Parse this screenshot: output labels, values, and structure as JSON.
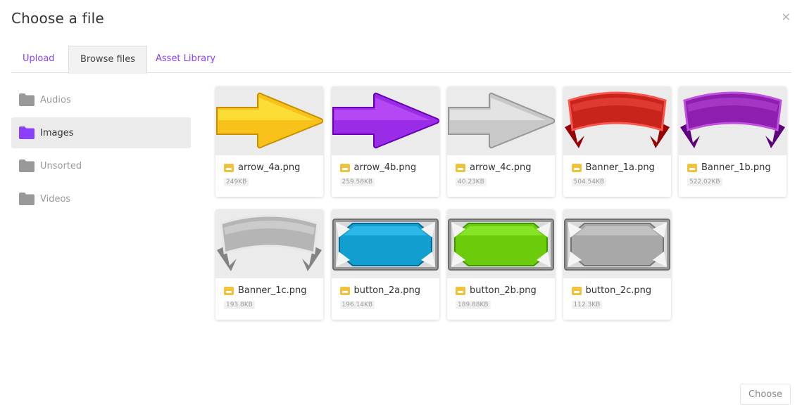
{
  "dialog": {
    "title": "Choose a file",
    "close_glyph": "×"
  },
  "tabs": [
    {
      "label": "Upload",
      "active": false
    },
    {
      "label": "Browse files",
      "active": true
    },
    {
      "label": "Asset Library",
      "active": false
    }
  ],
  "sidebar": {
    "items": [
      {
        "label": "Audios",
        "icon": "folder-icon",
        "color": "#999999",
        "active": false
      },
      {
        "label": "Images",
        "icon": "folder-icon",
        "color": "#8a3ffc",
        "active": true
      },
      {
        "label": "Unsorted",
        "icon": "folder-icon",
        "color": "#999999",
        "active": false
      },
      {
        "label": "Videos",
        "icon": "folder-icon",
        "color": "#999999",
        "active": false
      }
    ]
  },
  "files": [
    {
      "name": "arrow_4a.png",
      "size": "249KB",
      "thumb": "arrow",
      "color": "#f9c21a"
    },
    {
      "name": "arrow_4b.png",
      "size": "259.58KB",
      "thumb": "arrow",
      "color": "#9a2ce8"
    },
    {
      "name": "arrow_4c.png",
      "size": "40.23KB",
      "thumb": "arrow",
      "color": "#c8c8c8"
    },
    {
      "name": "Banner_1a.png",
      "size": "504.54KB",
      "thumb": "banner",
      "color": "#c8241c"
    },
    {
      "name": "Banner_1b.png",
      "size": "522.02KB",
      "thumb": "banner",
      "color": "#8e1fae"
    },
    {
      "name": "Banner_1c.png",
      "size": "193.8KB",
      "thumb": "banner",
      "color": "#b5b5b5"
    },
    {
      "name": "button_2a.png",
      "size": "196.14KB",
      "thumb": "button",
      "color": "#129fd0"
    },
    {
      "name": "button_2b.png",
      "size": "189.88KB",
      "thumb": "button",
      "color": "#6ccc0c"
    },
    {
      "name": "button_2c.png",
      "size": "112.3KB",
      "thumb": "button",
      "color": "#a8a8a8"
    }
  ],
  "footer": {
    "choose_label": "Choose"
  },
  "colors": {
    "accent": "#8a3ffc",
    "file_icon": "#f2c23a"
  }
}
